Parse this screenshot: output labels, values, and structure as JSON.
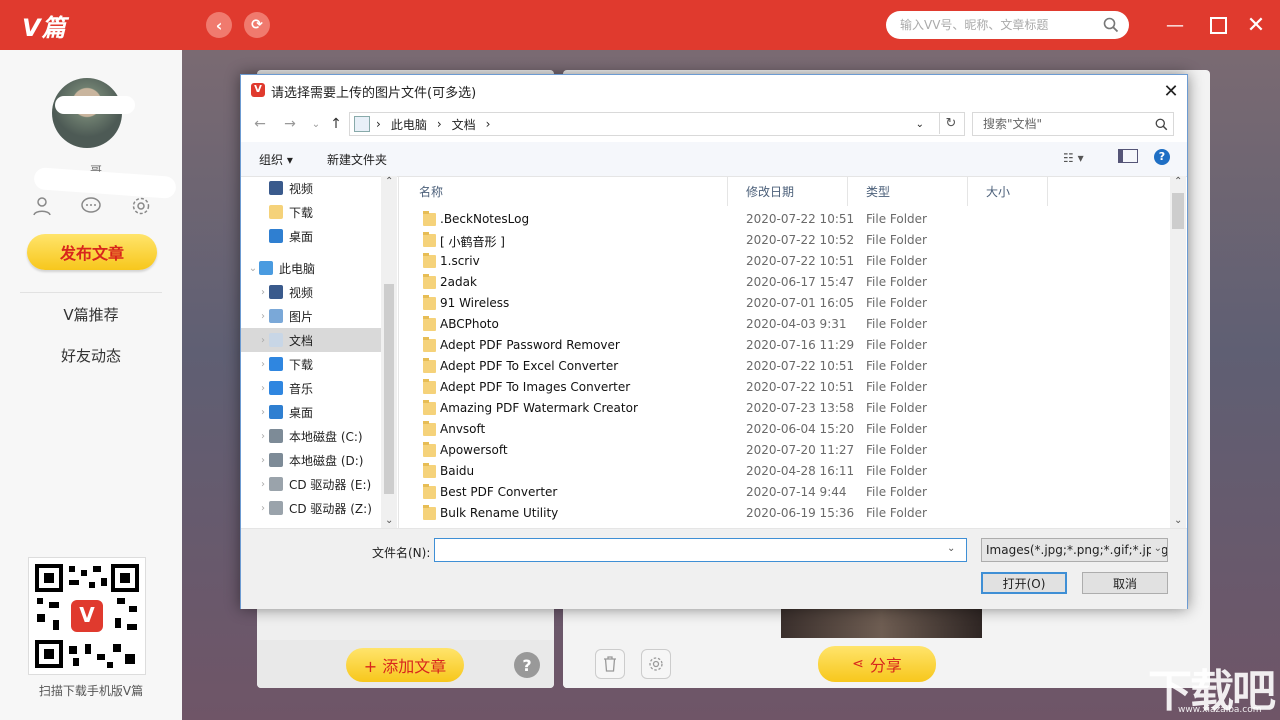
{
  "app": {
    "logo": "V篇",
    "search_placeholder": "输入VV号、昵称、文章标题",
    "username_suffix": "哥",
    "publish_label": "发布文章",
    "nav": [
      "V篇推荐",
      "好友动态"
    ],
    "qr_caption": "扫描下载手机版V篇",
    "add_article_label": "+ 添加文章",
    "share_label": "分享",
    "accent": "#e03a2e"
  },
  "watermark": {
    "main": "下载吧",
    "sub": "www.xiazaiba.com"
  },
  "dialog": {
    "title": "请选择需要上传的图片文件(可多选)",
    "breadcrumb": [
      "此电脑",
      "文档"
    ],
    "search_placeholder": "搜索\"文档\"",
    "toolbar": {
      "organize": "组织 ▾",
      "new_folder": "新建文件夹"
    },
    "nav_items": [
      {
        "label": "视频",
        "icon": "video-icon",
        "level": 1,
        "expander": false
      },
      {
        "label": "下载",
        "icon": "folder-icon",
        "level": 1,
        "expander": false
      },
      {
        "label": "桌面",
        "icon": "desktop-icon",
        "level": 1,
        "expander": false
      },
      {
        "label": "此电脑",
        "icon": "computer-icon",
        "level": 0,
        "expander": true
      },
      {
        "label": "视频",
        "icon": "video-icon",
        "level": 1,
        "expander": true
      },
      {
        "label": "图片",
        "icon": "pictures-icon",
        "level": 1,
        "expander": true
      },
      {
        "label": "文档",
        "icon": "documents-icon",
        "level": 1,
        "expander": true,
        "selected": true
      },
      {
        "label": "下载",
        "icon": "download-icon",
        "level": 1,
        "expander": true
      },
      {
        "label": "音乐",
        "icon": "music-icon",
        "level": 1,
        "expander": true
      },
      {
        "label": "桌面",
        "icon": "desktop-icon",
        "level": 1,
        "expander": true
      },
      {
        "label": "本地磁盘 (C:)",
        "icon": "drive-icon",
        "level": 1,
        "expander": true
      },
      {
        "label": "本地磁盘 (D:)",
        "icon": "drive-icon",
        "level": 1,
        "expander": true
      },
      {
        "label": "CD 驱动器 (E:)",
        "icon": "cd-drive-icon",
        "level": 1,
        "expander": true
      },
      {
        "label": "CD 驱动器 (Z:)",
        "icon": "cd-drive-icon",
        "level": 1,
        "expander": true
      }
    ],
    "columns": [
      "名称",
      "修改日期",
      "类型",
      "大小"
    ],
    "files": [
      {
        "name": ".BeckNotesLog",
        "date": "2020-07-22 10:51",
        "type": "File Folder"
      },
      {
        "name": "[ 小鹤音形 ]",
        "date": "2020-07-22 10:52",
        "type": "File Folder"
      },
      {
        "name": "1.scriv",
        "date": "2020-07-22 10:51",
        "type": "File Folder"
      },
      {
        "name": "2adak",
        "date": "2020-06-17 15:47",
        "type": "File Folder"
      },
      {
        "name": "91 Wireless",
        "date": "2020-07-01 16:05",
        "type": "File Folder"
      },
      {
        "name": "ABCPhoto",
        "date": "2020-04-03 9:31",
        "type": "File Folder"
      },
      {
        "name": "Adept PDF Password Remover",
        "date": "2020-07-16 11:29",
        "type": "File Folder"
      },
      {
        "name": "Adept PDF To Excel Converter",
        "date": "2020-07-22 10:51",
        "type": "File Folder"
      },
      {
        "name": "Adept PDF To Images Converter",
        "date": "2020-07-22 10:51",
        "type": "File Folder"
      },
      {
        "name": "Amazing PDF Watermark Creator",
        "date": "2020-07-23 13:58",
        "type": "File Folder"
      },
      {
        "name": "Anvsoft",
        "date": "2020-06-04 15:20",
        "type": "File Folder"
      },
      {
        "name": "Apowersoft",
        "date": "2020-07-20 11:27",
        "type": "File Folder"
      },
      {
        "name": "Baidu",
        "date": "2020-04-28 16:11",
        "type": "File Folder"
      },
      {
        "name": "Best PDF Converter",
        "date": "2020-07-14 9:44",
        "type": "File Folder"
      },
      {
        "name": "Bulk Rename Utility",
        "date": "2020-06-19 15:36",
        "type": "File Folder"
      }
    ],
    "filename_label": "文件名(N):",
    "filename_value": "",
    "filter": "Images(*.jpg;*.png;*.gif;*.jpeg)",
    "open_label": "打开(O)",
    "cancel_label": "取消"
  }
}
